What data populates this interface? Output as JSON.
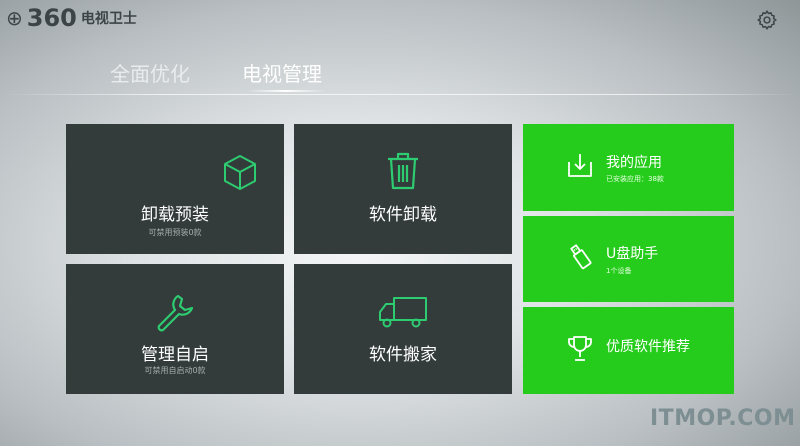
{
  "app": {
    "logo_number": "360",
    "logo_name": "电视卫士"
  },
  "tabs": [
    {
      "label": "全面优化"
    },
    {
      "label": "电视管理"
    }
  ],
  "tiles": [
    {
      "title": "卸载预装",
      "subtitle": "可禁用预装0款",
      "icon": "box-icon"
    },
    {
      "title": "软件卸载",
      "icon": "trash-icon"
    },
    {
      "title": "管理自启",
      "subtitle": "可禁用自启动0款",
      "icon": "wrench-icon"
    },
    {
      "title": "软件搬家",
      "icon": "truck-icon"
    }
  ],
  "side_tiles": [
    {
      "title": "我的应用",
      "subtitle": "已安装应用：38款",
      "icon": "download-icon"
    },
    {
      "title": "U盘助手",
      "subtitle": "1个设备",
      "icon": "usb-icon"
    },
    {
      "title": "优质软件推荐",
      "icon": "trophy-icon"
    }
  ],
  "colors": {
    "dark_tile": "#333b3b",
    "green_tile": "#26cc1c",
    "icon_green": "#2ecc71"
  },
  "watermark": "ITMOP.COM"
}
